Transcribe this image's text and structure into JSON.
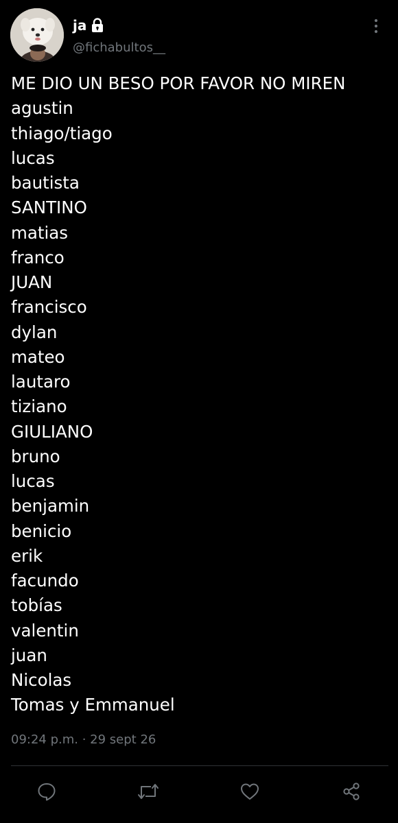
{
  "author": {
    "display_name": "ja",
    "handle": "@fichabultos__",
    "verified_lock": "lock-icon"
  },
  "tweet": {
    "lines": [
      "ME DIO UN BESO POR FAVOR NO MIREN",
      "agustin",
      "thiago/tiago",
      "lucas",
      "bautista",
      "SANTINO",
      "matias",
      "franco",
      "JUAN",
      "francisco",
      "dylan",
      "mateo",
      "lautaro",
      "tiziano",
      "GIULIANO",
      "bruno",
      "lucas",
      "benjamin",
      "benicio",
      "erik",
      "facundo",
      "tobías",
      "valentin",
      "juan",
      "Nicolas",
      "Tomas y Emmanuel"
    ],
    "timestamp": "09:24 p.m. · 29 sept 26"
  },
  "actions": {
    "icons": [
      "reply-icon",
      "retweet-icon",
      "like-icon",
      "share-icon"
    ]
  },
  "colors": {
    "background": "#000000",
    "text": "#ffffff",
    "secondary_text": "#71767b",
    "divider": "#2f3336",
    "icon": "#71767b"
  }
}
